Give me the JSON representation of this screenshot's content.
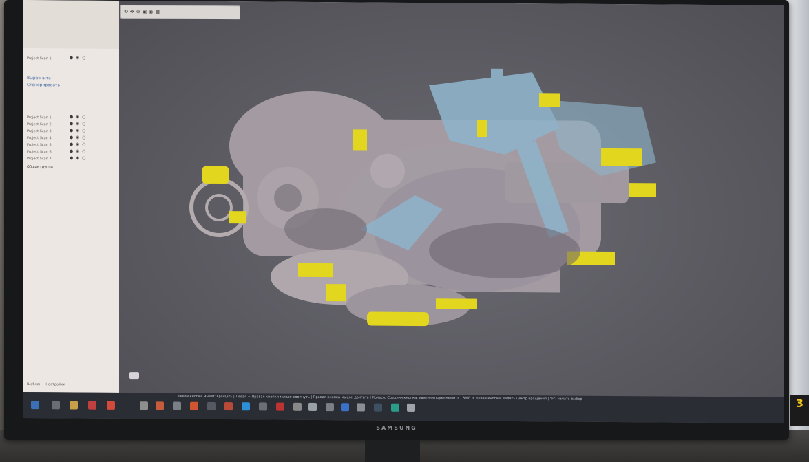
{
  "monitor": {
    "brand": "SAMSUNG"
  },
  "left_panel": {
    "rows": [
      {
        "label": "Project Scan 1"
      },
      {
        "label": "Выравнить"
      },
      {
        "label": "Сгенерировать"
      },
      {
        "label": "Project Scan 1"
      },
      {
        "label": "Project Scan 2"
      },
      {
        "label": "Project Scan 3"
      },
      {
        "label": "Project Scan 4"
      },
      {
        "label": "Project Scan 5"
      },
      {
        "label": "Project Scan 6"
      },
      {
        "label": "Project Scan 7"
      },
      {
        "label": "Общая группа"
      }
    ],
    "footer": [
      "Шаблон",
      "Настройки"
    ]
  },
  "viewport": {
    "toolbar_icons": [
      "rotate-icon",
      "pan-icon",
      "zoom-icon",
      "select-icon",
      "eye-icon",
      "grid-icon"
    ]
  },
  "status_bar": {
    "hint": "Левая кнопка мыши: вращать | Левая + Правая кнопки мыши: сдвинуть | Правая кнопка мыши: двигать | Колесо, Средняя кнопка: увеличить/уменьшить | Shift + Левая кнопка: задать центр вращения | \"F\": начать выбор"
  },
  "colors": {
    "panel_bg": "#ece7e2",
    "viewport_bg": "#5c5b62",
    "scan_gray": "#a89fa6",
    "scan_blue": "#8fb3c9",
    "scan_yellow": "#e3d61e"
  }
}
